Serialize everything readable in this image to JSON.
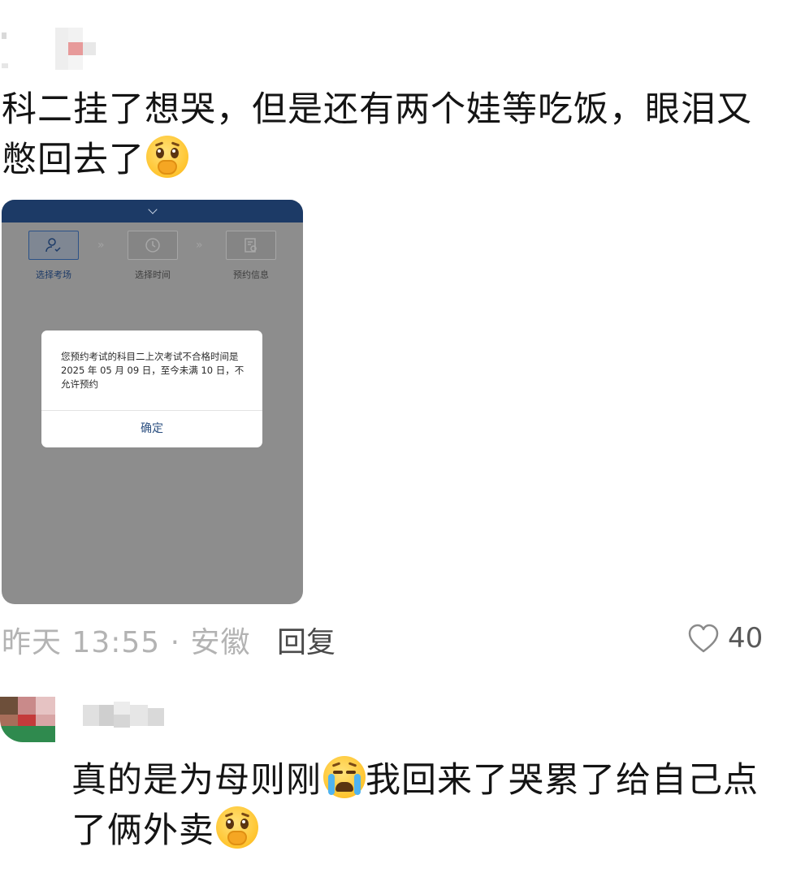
{
  "post": {
    "text": "科二挂了想哭，但是还有两个娃等吃饭，眼泪又憋回去了",
    "emoji": "holding-back-tears-emoji"
  },
  "screenshot": {
    "steps": [
      {
        "label": "选择考场",
        "icon": "user-check-icon",
        "active": true
      },
      {
        "label": "选择时间",
        "icon": "clock-icon",
        "active": false
      },
      {
        "label": "预约信息",
        "icon": "document-search-icon",
        "active": false
      }
    ],
    "dialog": {
      "message": "您预约考试的科目二上次考试不合格时间是 2025 年 05 月 09 日，至今未满 10 日，不允许预约",
      "confirm_label": "确定"
    }
  },
  "meta": {
    "time_location": "昨天 13:55 · 安徽",
    "reply_label": "回复",
    "like_count": "40"
  },
  "reply": {
    "text_part1": "真的是为母则刚",
    "emoji1": "loudly-crying-emoji",
    "text_part2": "我回来了哭累了给自己点了俩外卖",
    "emoji2": "holding-back-tears-emoji"
  },
  "colors": {
    "header_navy": "#1c3a66",
    "dialog_button": "#2b4f80",
    "meta_gray": "#b3b3b3"
  }
}
